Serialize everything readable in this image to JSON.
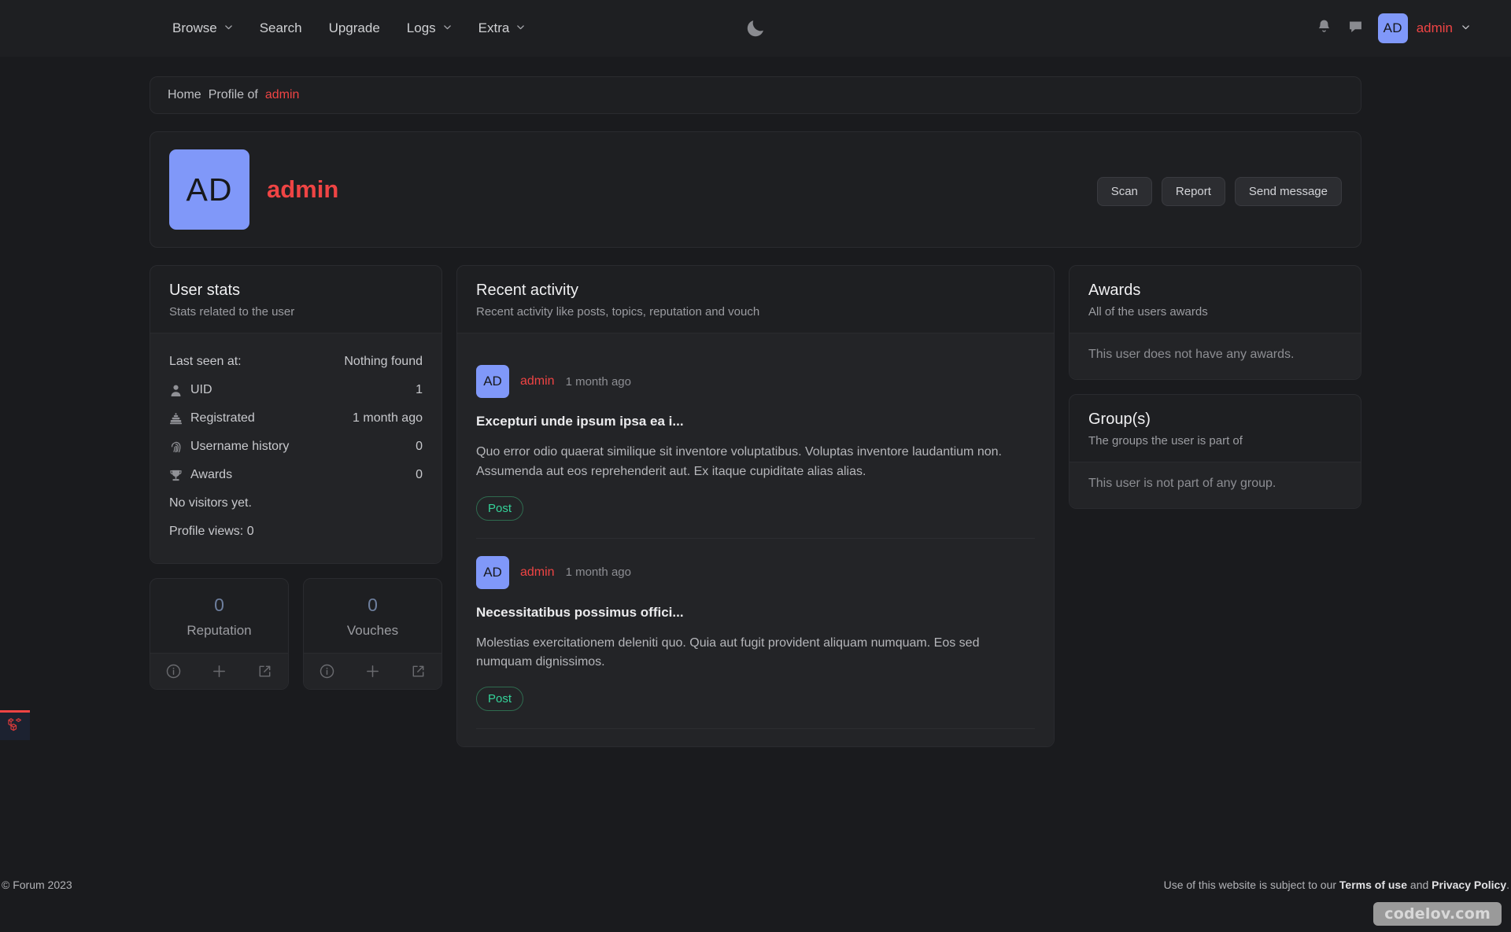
{
  "navbar": {
    "items": [
      {
        "label": "Browse",
        "caret": true
      },
      {
        "label": "Search",
        "caret": false
      },
      {
        "label": "Upgrade",
        "caret": false
      },
      {
        "label": "Logs",
        "caret": true
      },
      {
        "label": "Extra",
        "caret": true
      }
    ],
    "theme_toggle_icon": "moon-icon",
    "notifications_icon": "bell-icon",
    "messages_icon": "chat-bubble-icon",
    "user": {
      "initials": "AD",
      "name": "admin"
    },
    "avatar_color": "#8098f9",
    "accent_color": "#ef4444"
  },
  "breadcrumb": {
    "home": "Home",
    "current": "Profile of",
    "username": "admin"
  },
  "profile": {
    "initials": "AD",
    "name": "admin",
    "actions": [
      {
        "label": "Scan"
      },
      {
        "label": "Report"
      },
      {
        "label": "Send message"
      }
    ]
  },
  "user_stats": {
    "title": "User stats",
    "subtitle": "Stats related to the user",
    "last_seen_label": "Last seen at:",
    "last_seen_value": "Nothing found",
    "rows": [
      {
        "icon": "user-icon",
        "label": "UID",
        "value": "1"
      },
      {
        "icon": "cake-icon",
        "label": "Registrated",
        "value": "1 month ago"
      },
      {
        "icon": "fingerprint-icon",
        "label": "Username history",
        "value": "0"
      },
      {
        "icon": "trophy-icon",
        "label": "Awards",
        "value": "0"
      }
    ],
    "visitors_text": "No visitors yet.",
    "profile_views_text": "Profile views: 0"
  },
  "mini_stats": [
    {
      "value": "0",
      "label": "Reputation"
    },
    {
      "value": "0",
      "label": "Vouches"
    }
  ],
  "mini_icons": [
    "info-icon",
    "plus-icon",
    "external-link-icon"
  ],
  "recent_activity": {
    "title": "Recent activity",
    "subtitle": "Recent activity like posts, topics, reputation and vouch",
    "items": [
      {
        "initials": "AD",
        "user": "admin",
        "time": "1 month ago",
        "title": "Excepturi unde ipsum ipsa ea i...",
        "text": "Quo error odio quaerat similique sit inventore voluptatibus. Voluptas inventore laudantium non. Assumenda aut eos reprehenderit aut. Ex itaque cupiditate alias alias.",
        "badge": "Post"
      },
      {
        "initials": "AD",
        "user": "admin",
        "time": "1 month ago",
        "title": "Necessitatibus possimus offici...",
        "text": "Molestias exercitationem deleniti quo. Quia aut fugit provident aliquam numquam. Eos sed numquam dignissimos.",
        "badge": "Post"
      }
    ]
  },
  "awards": {
    "title": "Awards",
    "subtitle": "All of the users awards",
    "empty": "This user does not have any awards."
  },
  "groups": {
    "title": "Group(s)",
    "subtitle": "The groups the user is part of",
    "empty": "This user is not part of any group."
  },
  "footer": {
    "copyright": "© Forum 2023",
    "legal_prefix": "Use of this website is subject to our ",
    "terms": "Terms of use",
    "legal_join": " and ",
    "privacy": "Privacy Policy",
    "legal_suffix": "."
  },
  "watermark": "codelov.com",
  "debugbar_icon": "laravel-logo-icon"
}
